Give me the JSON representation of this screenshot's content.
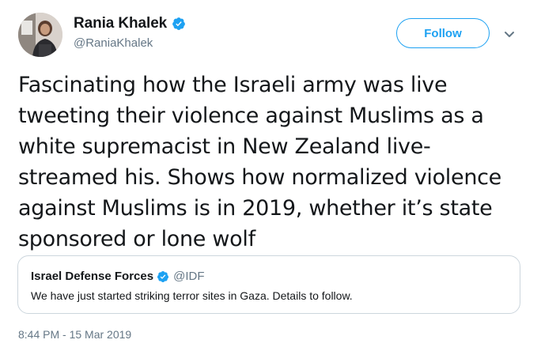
{
  "author": {
    "display_name": "Rania Khalek",
    "handle": "@RaniaKhalek",
    "verified": true
  },
  "actions": {
    "follow_label": "Follow",
    "more_icon": "chevron-down-icon"
  },
  "tweet": {
    "text": "Fascinating how the Israeli army was live tweeting their violence against Muslims as a white supremacist in New Zealand live-streamed his. Shows how normalized violence against Muslims is in 2019, whether it’s state sponsored or lone wolf"
  },
  "quoted_tweet": {
    "display_name": "Israel Defense Forces",
    "handle": "@IDF",
    "verified": true,
    "text": "We have just started striking terror sites in Gaza. Details to follow."
  },
  "timestamp": "8:44 PM - 15 Mar 2019",
  "colors": {
    "accent": "#1da1f2",
    "text": "#14171a",
    "secondary": "#657786",
    "border": "#ccd6dd"
  }
}
